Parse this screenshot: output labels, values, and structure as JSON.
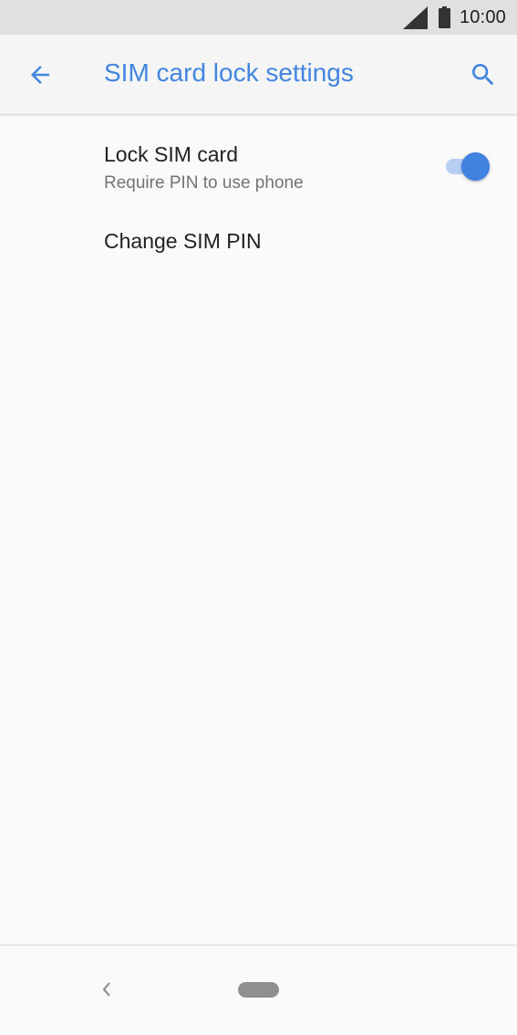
{
  "status_bar": {
    "time": "10:00",
    "icons": [
      "signal-icon",
      "battery-icon"
    ]
  },
  "app_bar": {
    "title": "SIM card lock settings",
    "back_icon": "arrow-left-icon",
    "search_icon": "search-icon"
  },
  "settings": {
    "lock_sim": {
      "title": "Lock SIM card",
      "summary": "Require PIN to use phone",
      "enabled": true
    },
    "change_pin": {
      "title": "Change SIM PIN"
    }
  },
  "nav_bar": {
    "back_icon": "chevron-left-icon",
    "home_icon": "home-pill-icon"
  },
  "colors": {
    "accent": "#4285e0",
    "toggle_thumb": "#3f82e0",
    "toggle_track": "#b7cff5",
    "status_bar_bg": "#e0e0e0",
    "app_bar_bg": "#f5f5f5",
    "background": "#fafafa",
    "primary_text": "#212121",
    "secondary_text": "#737373"
  }
}
